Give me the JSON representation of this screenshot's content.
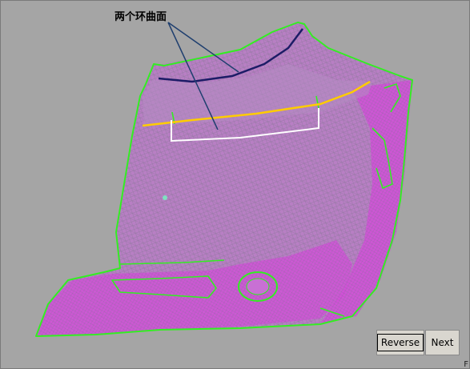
{
  "annotation": {
    "text": "两个环曲面"
  },
  "buttons": {
    "reverse": "Reverse",
    "next": "Next"
  },
  "corner_mark": "F",
  "colors": {
    "background": "#a5a5a5",
    "mesh": "#c64fd0",
    "boundary": "#33ee22",
    "ring_upper": "#1c1c66",
    "ring_lower": "#ffffff",
    "highlight": "#ffcc00",
    "leader_line": "#1f3f6f"
  }
}
